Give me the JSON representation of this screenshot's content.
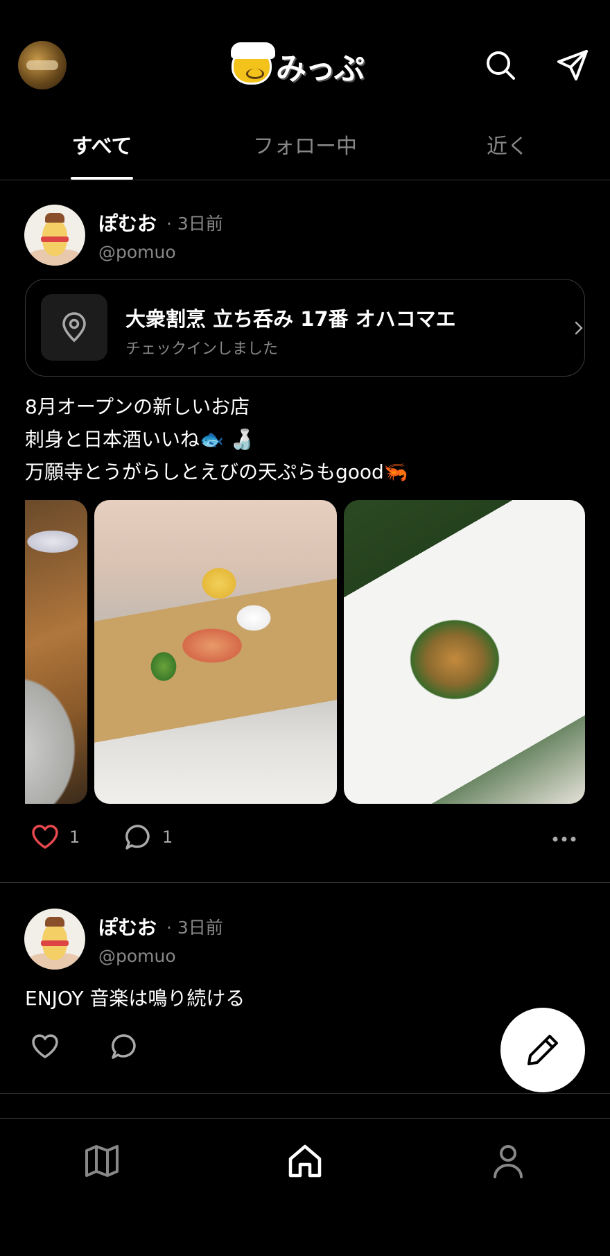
{
  "header": {
    "logo_text": "みっぷ",
    "avatar_icon": "user-avatar",
    "search_icon": "search-icon",
    "send_icon": "paper-plane-icon"
  },
  "tabs": [
    {
      "label": "すべて",
      "active": true
    },
    {
      "label": "フォロー中",
      "active": false
    },
    {
      "label": "近く",
      "active": false
    }
  ],
  "posts": [
    {
      "user_name": "ぽむお",
      "time": "· 3日前",
      "handle": "@pomuo",
      "checkin": {
        "place": "大衆割烹 立ち呑み 17番 オハコマエ",
        "sub": "チェックインしました"
      },
      "text_lines": [
        "8月オープンの新しいお店",
        "刺身と日本酒いいね🐟 🍶",
        "万願寺とうがらしとえびの天ぷらもgood🦐"
      ],
      "photos": [
        "dish-partial",
        "sashimi-platter",
        "tempura"
      ],
      "likes": "1",
      "comments": "1",
      "liked": true
    },
    {
      "user_name": "ぽむお",
      "time": "· 3日前",
      "handle": "@pomuo",
      "text_lines": [
        "ENJOY 音楽は鳴り続ける"
      ],
      "likes": "",
      "comments": "",
      "liked": false
    }
  ],
  "fab": {
    "icon": "pencil-icon"
  },
  "bottom_nav": [
    {
      "icon": "map-icon",
      "active": false
    },
    {
      "icon": "home-icon",
      "active": true
    },
    {
      "icon": "profile-icon",
      "active": false
    }
  ],
  "colors": {
    "background": "#000000",
    "like_red": "#e5484d",
    "muted_text": "#888888",
    "divider": "#333333"
  }
}
